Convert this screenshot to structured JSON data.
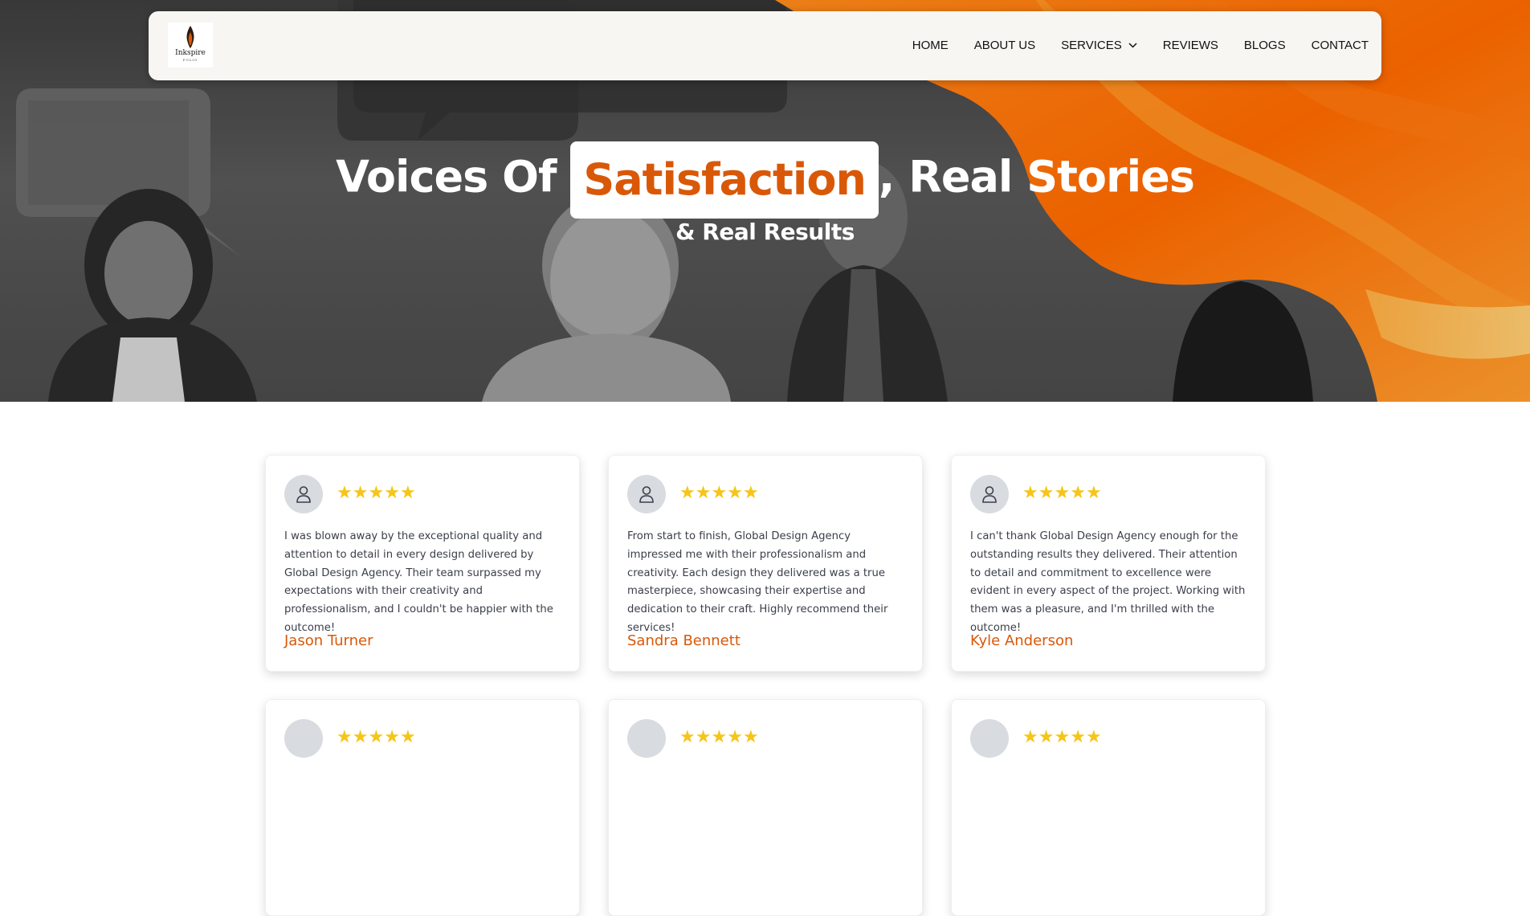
{
  "brand": {
    "logo_name": "Inkspire",
    "logo_sub": "FOLIO"
  },
  "nav": {
    "items": [
      {
        "label": "HOME"
      },
      {
        "label": "ABOUT US"
      },
      {
        "label": "SERVICES",
        "has_dropdown": true
      },
      {
        "label": "REVIEWS"
      },
      {
        "label": "BLOGS"
      },
      {
        "label": "CONTACT"
      }
    ]
  },
  "hero": {
    "headline_before": "Voices Of",
    "headline_highlight": "Satisfaction",
    "headline_after": ", Real Stories",
    "subline": "& Real Results"
  },
  "colors": {
    "accent": "#d95808",
    "star": "#f5c518",
    "navbar_bg": "#f7f6f2"
  },
  "reviews": [
    {
      "rating": 5,
      "text": "I was blown away by the exceptional quality and attention to detail in every design delivered by Global Design Agency. Their team surpassed my expectations with their creativity and professionalism, and I couldn't be happier with the outcome!",
      "name": "Jason Turner"
    },
    {
      "rating": 5,
      "text": "From start to finish, Global Design Agency impressed me with their professionalism and creativity. Each design they delivered was a true masterpiece, showcasing their expertise and dedication to their craft. Highly recommend their services!",
      "name": "Sandra Bennett"
    },
    {
      "rating": 5,
      "text": "I can't thank Global Design Agency enough for the outstanding results they delivered. Their attention to detail and commitment to excellence were evident in every aspect of the project. Working with them was a pleasure, and I'm thrilled with the outcome!",
      "name": "Kyle Anderson"
    }
  ]
}
